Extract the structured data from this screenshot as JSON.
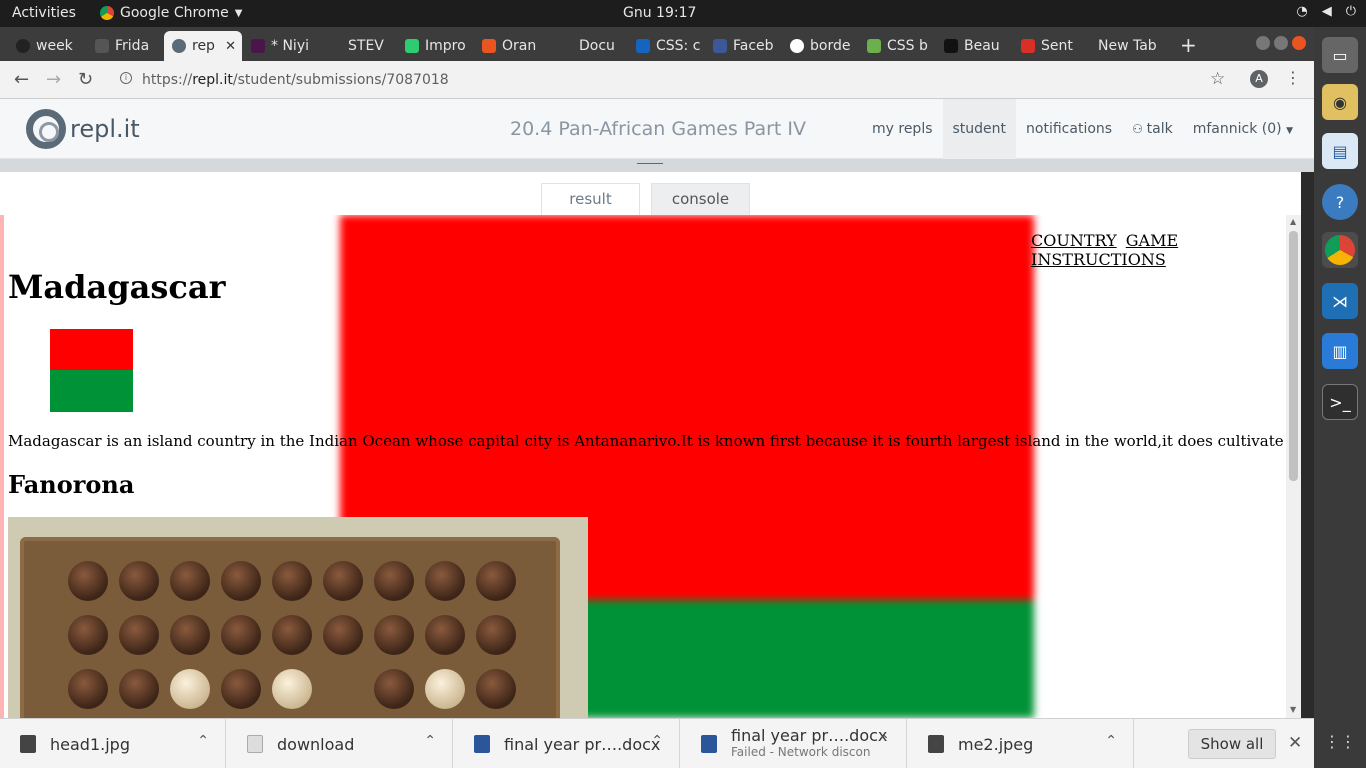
{
  "system": {
    "activities": "Activities",
    "app_name": "Google Chrome",
    "clock": "Gnu 19:17"
  },
  "tabs": [
    {
      "label": "week",
      "color": "#333333"
    },
    {
      "label": "Frida",
      "color": "#555555"
    },
    {
      "label": "rep",
      "color": "#5b6a77",
      "active": true
    },
    {
      "label": "* Niyi",
      "color": "#4a154b"
    },
    {
      "label": "STEV",
      "color": "#3c3c3c"
    },
    {
      "label": "Impro",
      "color": "#2ecc71"
    },
    {
      "label": "Oran",
      "color": "#e95420"
    },
    {
      "label": "Docu",
      "color": "#3c3c3c"
    },
    {
      "label": "CSS: c",
      "color": "#1565c0"
    },
    {
      "label": "Faceb",
      "color": "#3b5998"
    },
    {
      "label": "borde",
      "color": "#ffffff"
    },
    {
      "label": "CSS b",
      "color": "#6ab04c"
    },
    {
      "label": "Beau",
      "color": "#111111"
    },
    {
      "label": "Sent",
      "color": "#d93025"
    },
    {
      "label": "New Tab",
      "color": ""
    }
  ],
  "browser": {
    "url_scheme": "https://",
    "url_host": "repl.it",
    "url_path": "/student/submissions/7087018",
    "avatar_letter": "A"
  },
  "repl": {
    "logo_text": "repl.it",
    "project_title": "20.4 Pan-African Games Part IV",
    "nav": [
      {
        "label": "my repls"
      },
      {
        "label": "student"
      },
      {
        "label": "notifications"
      },
      {
        "label": "talk"
      },
      {
        "label": "mfannick (0)"
      }
    ],
    "result_tab": "result",
    "console_tab": "console"
  },
  "page": {
    "nav_links": [
      "COUNTRY",
      "GAME",
      "INSTRUCTIONS"
    ],
    "heading": "Madagascar",
    "description": "Madagascar is an island country in the Indian Ocean whose capital city is Antananarivo.It is known first because it is fourth largest island in the world,it does cultivate pepper, vanilla & lemurs",
    "subheading": "Fanorona",
    "flag_colors": {
      "red": "#ff0000",
      "green": "#009236"
    }
  },
  "downloads": [
    {
      "name": "head1.jpg"
    },
    {
      "name": "download"
    },
    {
      "name": "final year pr….docx"
    },
    {
      "name": "final year pr….docx",
      "status": "Failed - Network discon"
    },
    {
      "name": "me2.jpeg"
    }
  ],
  "shelf": {
    "show_all": "Show all"
  }
}
